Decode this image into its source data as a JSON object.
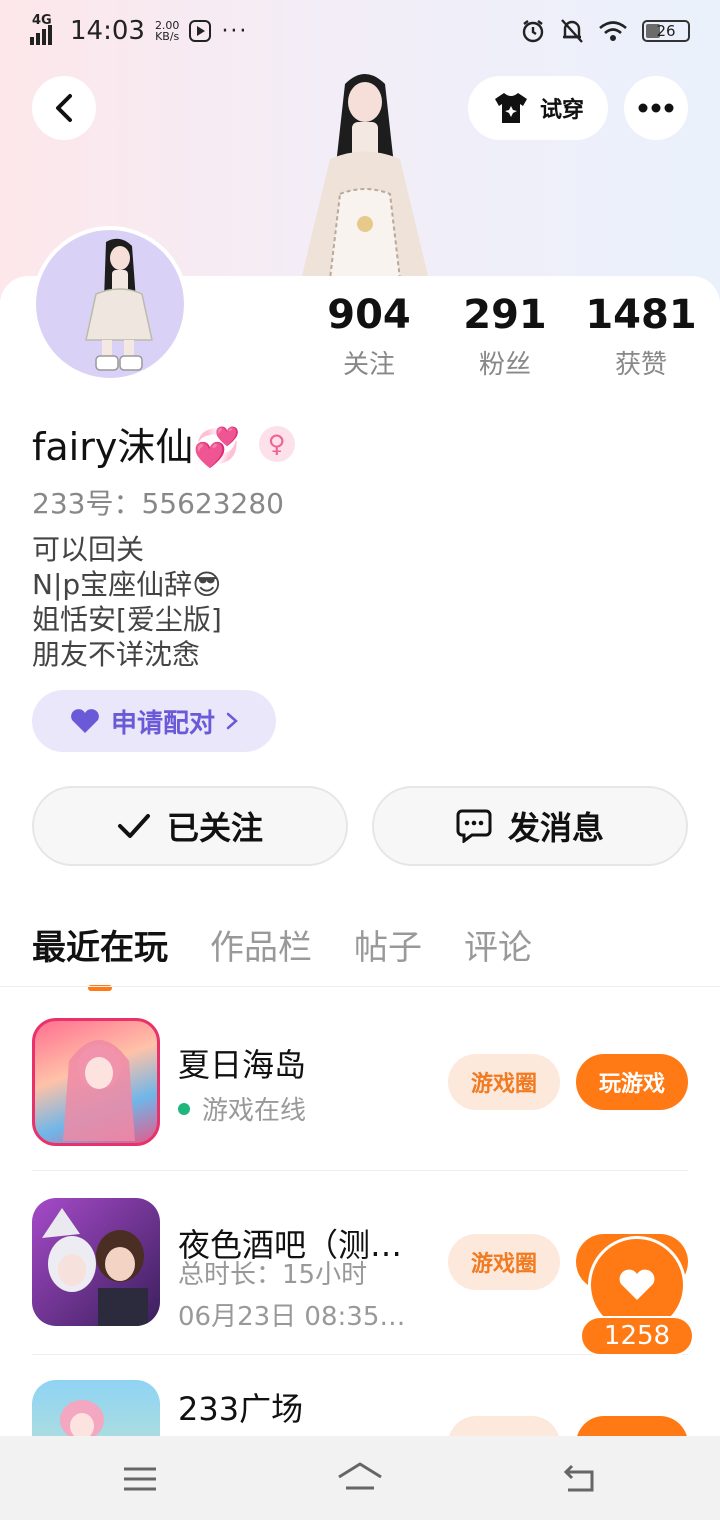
{
  "status_bar": {
    "network": "4G",
    "time": "14:03",
    "speed_value": "2.00",
    "speed_unit": "KB/s",
    "more": "···",
    "battery": "26"
  },
  "header": {
    "tryon_label": "试穿"
  },
  "profile": {
    "stats": [
      {
        "num": "904",
        "label": "关注"
      },
      {
        "num": "291",
        "label": "粉丝"
      },
      {
        "num": "1481",
        "label": "获赞"
      }
    ],
    "name": "fairy沫仙💞",
    "gender_symbol": "♀",
    "uid": "233号：55623280",
    "bio": [
      "可以回关",
      "N|p宝座仙辞😎",
      "姐恬安[爱尘版]",
      "朋友不详沈悆"
    ],
    "pair_label": "申请配对",
    "follow_label": "已关注",
    "message_label": "发消息"
  },
  "tabs": [
    "最近在玩",
    "作品栏",
    "帖子",
    "评论"
  ],
  "games": [
    {
      "title": "夏日海岛",
      "status": "游戏在线",
      "circle_label": "游戏圈",
      "play_label": "玩游戏"
    },
    {
      "title": "夜色酒吧（测…",
      "duration": "总时长：15小时",
      "time": "06月23日 08:35…",
      "circle_label": "游戏圈"
    },
    {
      "title": "233广场"
    }
  ],
  "floating_like": {
    "count": "1258"
  },
  "colors": {
    "accent": "#ff7a14",
    "pair": "#6a5ad8",
    "online": "#1fb67c"
  }
}
